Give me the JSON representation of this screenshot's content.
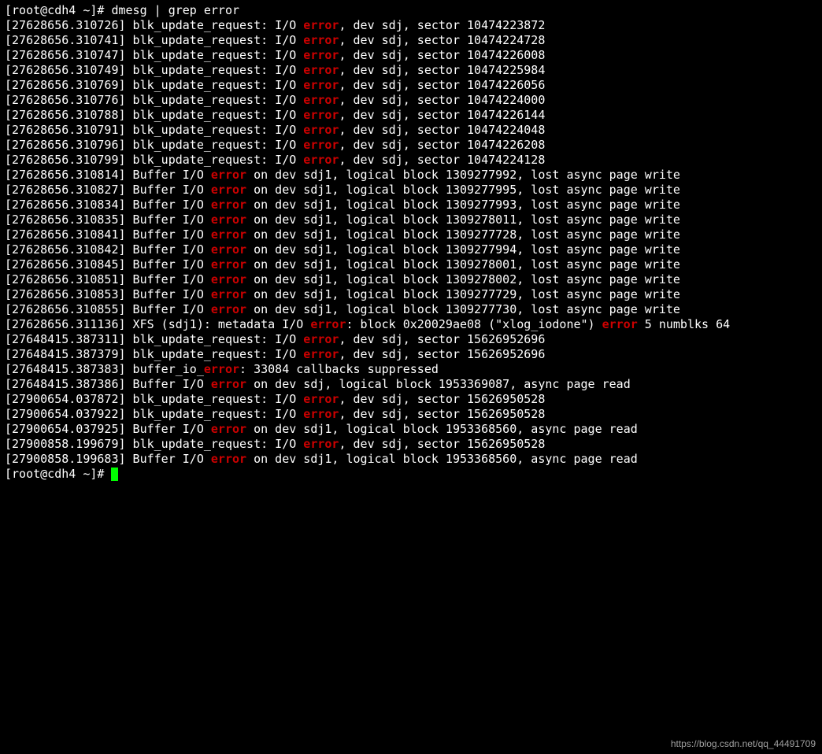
{
  "session": {
    "prompt_user": "root",
    "prompt_host": "cdh4",
    "prompt_path": "~",
    "prompt_prefix": "[root@cdh4 ~]# ",
    "command": "dmesg | grep error",
    "highlight_word": "error",
    "watermark": "https://blog.csdn.net/qq_44491709"
  },
  "blk_template": {
    "prefix": "blk_update_request: I/O ",
    "word": "error",
    "suffix_a": ", dev sdj, sector "
  },
  "buf_template": {
    "prefix": "Buffer I/O ",
    "word": "error",
    "mid_dev": " on dev ",
    "mid_blk": ", logical block ",
    "tail_lost": ", lost async page write",
    "tail_read": ", async page read"
  },
  "blk_lines": [
    {
      "ts": "27628656.310726",
      "sector": "10474223872"
    },
    {
      "ts": "27628656.310741",
      "sector": "10474224728"
    },
    {
      "ts": "27628656.310747",
      "sector": "10474226008"
    },
    {
      "ts": "27628656.310749",
      "sector": "10474225984"
    },
    {
      "ts": "27628656.310769",
      "sector": "10474226056"
    },
    {
      "ts": "27628656.310776",
      "sector": "10474224000"
    },
    {
      "ts": "27628656.310788",
      "sector": "10474226144"
    },
    {
      "ts": "27628656.310791",
      "sector": "10474224048"
    },
    {
      "ts": "27628656.310796",
      "sector": "10474226208"
    },
    {
      "ts": "27628656.310799",
      "sector": "10474224128"
    }
  ],
  "buf_lines": [
    {
      "ts": "27628656.310814",
      "dev": "sdj1",
      "block": "1309277992",
      "tail": "lost"
    },
    {
      "ts": "27628656.310827",
      "dev": "sdj1",
      "block": "1309277995",
      "tail": "lost"
    },
    {
      "ts": "27628656.310834",
      "dev": "sdj1",
      "block": "1309277993",
      "tail": "lost"
    },
    {
      "ts": "27628656.310835",
      "dev": "sdj1",
      "block": "1309278011",
      "tail": "lost"
    },
    {
      "ts": "27628656.310841",
      "dev": "sdj1",
      "block": "1309277728",
      "tail": "lost"
    },
    {
      "ts": "27628656.310842",
      "dev": "sdj1",
      "block": "1309277994",
      "tail": "lost"
    },
    {
      "ts": "27628656.310845",
      "dev": "sdj1",
      "block": "1309278001",
      "tail": "lost"
    },
    {
      "ts": "27628656.310851",
      "dev": "sdj1",
      "block": "1309278002",
      "tail": "lost"
    },
    {
      "ts": "27628656.310853",
      "dev": "sdj1",
      "block": "1309277729",
      "tail": "lost"
    },
    {
      "ts": "27628656.310855",
      "dev": "sdj1",
      "block": "1309277730",
      "tail": "lost"
    }
  ],
  "xfs_line": {
    "ts": "27628656.311136",
    "fs": "XFS (sdj1): metadata I/O ",
    "word": "error",
    "mid1": ": block 0x20029ae08 (\"xlog_iodone\") ",
    "word2": "error",
    "mid2": " 5 numblks 64"
  },
  "tail_lines": [
    {
      "type": "blk",
      "ts": "27648415.387311",
      "sector": "15626952696"
    },
    {
      "type": "blk",
      "ts": "27648415.387379",
      "sector": "15626952696"
    },
    {
      "type": "buffer_io",
      "ts": "27648415.387383",
      "text_a": "buffer_io_",
      "word": "error",
      "text_b": ": 33084 callbacks suppressed"
    },
    {
      "type": "buf",
      "ts": "27648415.387386",
      "dev": "sdj",
      "block": "1953369087",
      "tail": "read"
    },
    {
      "type": "blk",
      "ts": "27900654.037872",
      "sector": "15626950528"
    },
    {
      "type": "blk",
      "ts": "27900654.037922",
      "sector": "15626950528"
    },
    {
      "type": "buf",
      "ts": "27900654.037925",
      "dev": "sdj1",
      "block": "1953368560",
      "tail": "read"
    },
    {
      "type": "blk",
      "ts": "27900858.199679",
      "sector": "15626950528"
    },
    {
      "type": "buf",
      "ts": "27900858.199683",
      "dev": "sdj1",
      "block": "1953368560",
      "tail": "read"
    }
  ]
}
